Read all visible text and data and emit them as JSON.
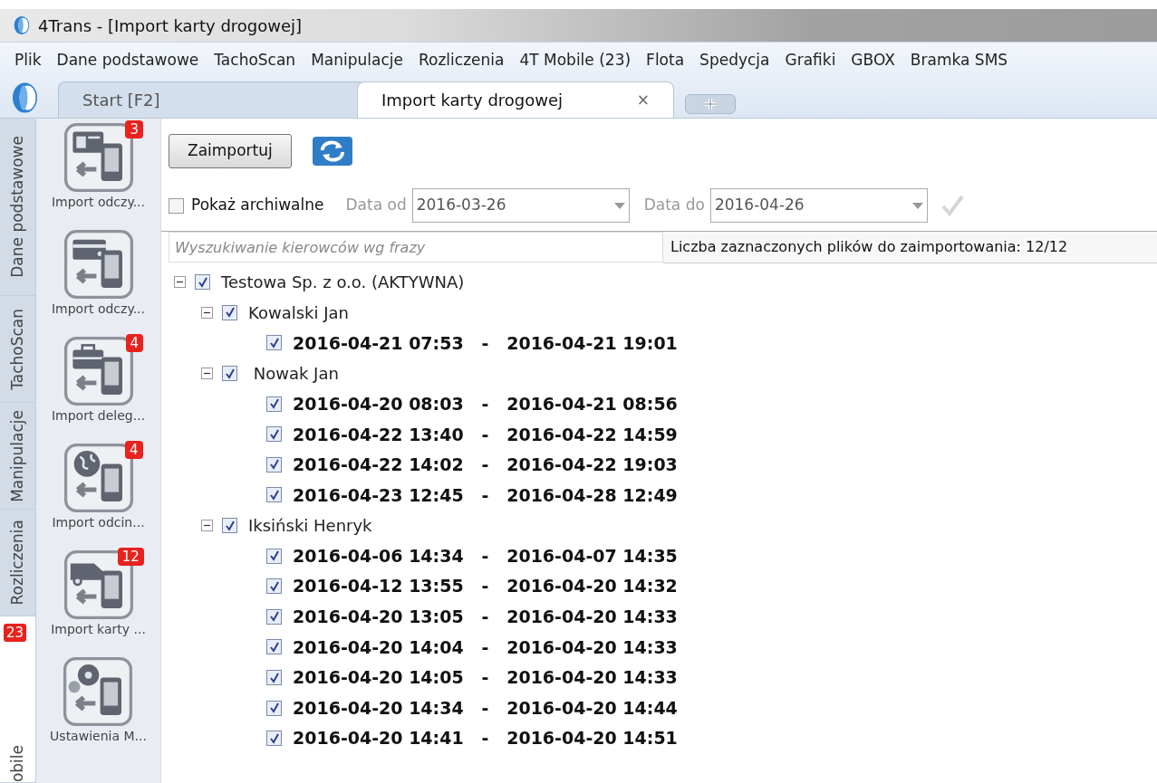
{
  "window": {
    "title": "4Trans - [Import karty drogowej]"
  },
  "menu": [
    "Plik",
    "Dane podstawowe",
    "TachoScan",
    "Manipulacje",
    "Rozliczenia",
    "4T Mobile (23)",
    "Flota",
    "Spedycja",
    "Grafiki",
    "GBOX",
    "Bramka SMS"
  ],
  "tabs": [
    {
      "label": "Start [F2]",
      "selected": false
    },
    {
      "label": "Import karty drogowej",
      "selected": true,
      "close": "×"
    }
  ],
  "side_tabs": [
    {
      "label": "Dane podstawowe",
      "selected": false
    },
    {
      "label": "TachoScan",
      "selected": false
    },
    {
      "label": "Manipulacje",
      "selected": false
    },
    {
      "label": "Rozliczenia",
      "selected": false
    },
    {
      "label": "obile",
      "selected": true,
      "badge": "23"
    }
  ],
  "modules": [
    {
      "label": "Import odczy...",
      "badge": "3"
    },
    {
      "label": "Import odczy..."
    },
    {
      "label": "Import deleg...",
      "badge": "4"
    },
    {
      "label": "Import odcin...",
      "badge": "4"
    },
    {
      "label": "Import karty ...",
      "badge": "12"
    },
    {
      "label": "Ustawienia M..."
    }
  ],
  "toolbar": {
    "import_button": "Zaimportuj"
  },
  "filters": {
    "archive": {
      "label": "Pokaż archiwalne",
      "checked": false
    },
    "date_from": {
      "label": "Data od",
      "value": "2016-03-26"
    },
    "date_to": {
      "label": "Data do",
      "value": "2016-04-26"
    }
  },
  "search": {
    "placeholder": "Wyszukiwanie kierowców wg frazy"
  },
  "selection_info": "Liczba zaznaczonych plików do zaimportowania: 12/12",
  "tree": [
    {
      "label": "Testowa Sp. z o.o. (AKTYWNA)",
      "checked": true,
      "expanded": true,
      "children": [
        {
          "label": "Kowalski Jan",
          "checked": true,
          "expanded": true,
          "children": [
            {
              "label": "2016-04-21 07:53   -   2016-04-21 19:01",
              "checked": true
            }
          ]
        },
        {
          "label": " Nowak Jan",
          "checked": true,
          "expanded": true,
          "children": [
            {
              "label": "2016-04-20 08:03   -   2016-04-21 08:56",
              "checked": true
            },
            {
              "label": "2016-04-22 13:40   -   2016-04-22 14:59",
              "checked": true
            },
            {
              "label": "2016-04-22 14:02   -   2016-04-22 19:03",
              "checked": true
            },
            {
              "label": "2016-04-23 12:45   -   2016-04-28 12:49",
              "checked": true
            }
          ]
        },
        {
          "label": "Iksiński Henryk",
          "checked": true,
          "expanded": true,
          "children": [
            {
              "label": "2016-04-06 14:34   -   2016-04-07 14:35",
              "checked": true
            },
            {
              "label": "2016-04-12 13:55   -   2016-04-20 14:32",
              "checked": true
            },
            {
              "label": "2016-04-20 13:05   -   2016-04-20 14:33",
              "checked": true
            },
            {
              "label": "2016-04-20 14:04   -   2016-04-20 14:33",
              "checked": true
            },
            {
              "label": "2016-04-20 14:05   -   2016-04-20 14:33",
              "checked": true
            },
            {
              "label": "2016-04-20 14:34   -   2016-04-20 14:44",
              "checked": true
            },
            {
              "label": "2016-04-20 14:41   -   2016-04-20 14:51",
              "checked": true
            }
          ]
        }
      ]
    }
  ]
}
